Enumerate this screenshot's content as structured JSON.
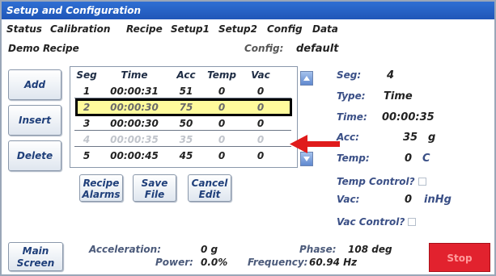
{
  "window": {
    "title": "Setup and Configuration"
  },
  "menu": {
    "items": [
      "Status",
      "Calibration",
      "Recipe",
      "Setup1",
      "Setup2",
      "Config",
      "Data"
    ]
  },
  "recipe": {
    "name": "Demo Recipe",
    "config_label": "Config:",
    "config_value": "default"
  },
  "left_buttons": {
    "add": "Add",
    "insert": "Insert",
    "delete": "Delete"
  },
  "table": {
    "headers": [
      "Seg",
      "Time",
      "Acc",
      "Temp",
      "Vac"
    ],
    "rows": [
      [
        "1",
        "00:00:31",
        "51",
        "0",
        "0"
      ],
      [
        "2",
        "00:00:30",
        "75",
        "0",
        "0"
      ],
      [
        "3",
        "00:00:30",
        "50",
        "0",
        "0"
      ],
      [
        "4",
        "00:00:35",
        "35",
        "0",
        "0"
      ],
      [
        "5",
        "00:00:45",
        "45",
        "0",
        "0"
      ]
    ]
  },
  "table_buttons": {
    "recipe_alarms": [
      "Recipe",
      "Alarms"
    ],
    "save_file": [
      "Save",
      "File"
    ],
    "cancel_edit": [
      "Cancel",
      "Edit"
    ]
  },
  "segment": {
    "seg_label": "Seg:",
    "seg_value": "4",
    "type_label": "Type:",
    "type_value": "Time",
    "time_label": "Time:",
    "time_value": "00:00:35",
    "acc_label": "Acc:",
    "acc_value": "35",
    "acc_unit": "g",
    "temp_label": "Temp:",
    "temp_value": "0",
    "temp_unit": "C",
    "temp_control_label": "Temp Control?",
    "vac_label": "Vac:",
    "vac_value": "0",
    "vac_unit": "inHg",
    "vac_control_label": "Vac Control?"
  },
  "bottom": {
    "main_screen": [
      "Main",
      "Screen"
    ],
    "acceleration_label": "Acceleration:",
    "acceleration_value": "0 g",
    "power_label": "Power:",
    "power_value": "0.0%",
    "phase_label": "Phase:",
    "phase_value": "108 deg",
    "frequency_label": "Frequency:",
    "frequency_value": "60.94 Hz",
    "stop": "Stop"
  },
  "colors": {
    "title_bar": "#1f56b8",
    "highlight": "#fffb9c",
    "arrow": "#e01b1b",
    "stop": "#e2222e"
  }
}
